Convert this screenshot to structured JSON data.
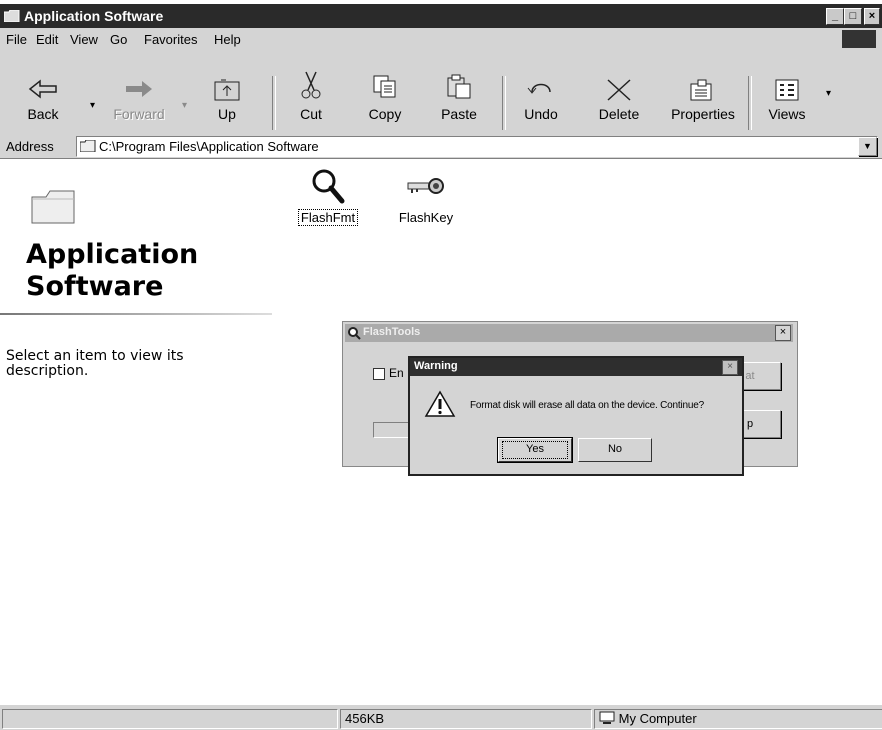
{
  "window": {
    "title": "Application Software",
    "controls": {
      "minimize": "_",
      "maximize": "□",
      "close": "×"
    }
  },
  "menu": {
    "items": [
      {
        "label": "File"
      },
      {
        "label": "Edit"
      },
      {
        "label": "View"
      },
      {
        "label": "Go"
      },
      {
        "label": "Favorites"
      },
      {
        "label": "Help"
      }
    ]
  },
  "toolbar": {
    "buttons": [
      {
        "label": "Back",
        "icon": "back-arrow-icon",
        "enabled": true
      },
      {
        "label": "Forward",
        "icon": "forward-arrow-icon",
        "enabled": false
      },
      {
        "label": "Up",
        "icon": "up-folder-icon",
        "enabled": true
      },
      {
        "label": "Cut",
        "icon": "scissors-icon",
        "enabled": true
      },
      {
        "label": "Copy",
        "icon": "copy-icon",
        "enabled": true
      },
      {
        "label": "Paste",
        "icon": "paste-icon",
        "enabled": true
      },
      {
        "label": "Undo",
        "icon": "undo-icon",
        "enabled": true
      },
      {
        "label": "Delete",
        "icon": "delete-x-icon",
        "enabled": true
      },
      {
        "label": "Properties",
        "icon": "properties-icon",
        "enabled": true
      },
      {
        "label": "Views",
        "icon": "views-grid-icon",
        "enabled": true
      }
    ]
  },
  "address": {
    "label": "Address",
    "value": "C:\\Program Files\\Application Software"
  },
  "left_pane": {
    "title_line1": "Application",
    "title_line2": "Software",
    "description": "Select an item to view its description."
  },
  "files": [
    {
      "label": "FlashFmt",
      "icon": "magnifier-icon",
      "selected": true
    },
    {
      "label": "FlashKey",
      "icon": "key-icon",
      "selected": false
    }
  ],
  "flashtools_dialog": {
    "title": "FlashTools",
    "checkbox_label": "En",
    "button_top_label": "at",
    "button_bottom_label": "p"
  },
  "warning_dialog": {
    "title": "Warning",
    "message": "Format disk will erase all data on the device. Continue?",
    "yes_label": "Yes",
    "no_label": "No",
    "icon": "exclamation-icon"
  },
  "status_bar": {
    "size": "456KB",
    "zone": "My Computer"
  },
  "colors": {
    "title_bar": "#2a2a2a",
    "face": "#d4d4d4",
    "window_bg": "#ffffff"
  }
}
